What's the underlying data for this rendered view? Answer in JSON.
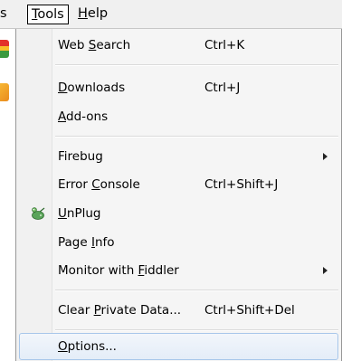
{
  "menubar": {
    "partial_label": "s",
    "tools": {
      "before": "",
      "accel": "T",
      "after": "ools"
    },
    "help": {
      "before": "",
      "accel": "H",
      "after": "elp"
    }
  },
  "icons": {
    "side_top": "google-toolbar-icon",
    "side_bottom": "rss-feed-icon",
    "unplug": "unplug-plugin-icon",
    "submenu_arrow": "submenu-arrow-icon"
  },
  "menu": {
    "items": [
      {
        "id": "web-search",
        "before": "Web ",
        "accel": "S",
        "after": "earch",
        "shortcut": "Ctrl+K"
      },
      {
        "id": "downloads",
        "before": "",
        "accel": "D",
        "after": "ownloads",
        "shortcut": "Ctrl+J"
      },
      {
        "id": "add-ons",
        "before": "",
        "accel": "A",
        "after": "dd-ons",
        "shortcut": ""
      },
      {
        "id": "firebug",
        "before": "Firebug",
        "accel": "",
        "after": "",
        "shortcut": ""
      },
      {
        "id": "error-console",
        "before": "Error ",
        "accel": "C",
        "after": "onsole",
        "shortcut": "Ctrl+Shift+J"
      },
      {
        "id": "unplug",
        "before": "",
        "accel": "U",
        "after": "nPlug",
        "shortcut": ""
      },
      {
        "id": "page-info",
        "before": "Page ",
        "accel": "I",
        "after": "nfo",
        "shortcut": ""
      },
      {
        "id": "monitor-fiddler",
        "before": "Monitor with ",
        "accel": "F",
        "after": "iddler",
        "shortcut": ""
      },
      {
        "id": "clear-private-data",
        "before": "Clear ",
        "accel": "P",
        "after": "rivate Data...",
        "shortcut": "Ctrl+Shift+Del"
      },
      {
        "id": "options",
        "before": "",
        "accel": "O",
        "after": "ptions...",
        "shortcut": ""
      }
    ]
  }
}
